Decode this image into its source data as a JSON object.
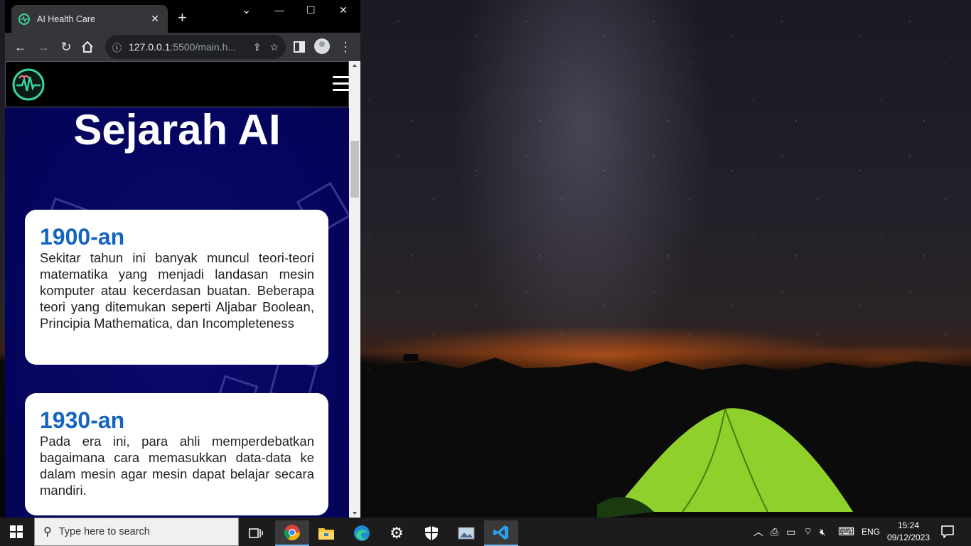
{
  "browser": {
    "tab_title": "AI Health Care",
    "tab_close": "✕",
    "new_tab": "+",
    "url_host": "127.0.0.1",
    "url_rest": ":5500/main.h...",
    "window_controls": {
      "minimize": "—",
      "maximize": "☐",
      "close": "✕",
      "tab_search": "⌄"
    }
  },
  "page": {
    "title": "Sejarah AI",
    "cards": [
      {
        "title": "1900-an",
        "text": "Sekitar tahun ini banyak muncul teori-teori matematika yang menjadi landasan mesin komputer atau kecerdasan buatan. Beberapa teori yang ditemukan seperti Aljabar Boolean, Principia Mathematica, dan Incompleteness"
      },
      {
        "title": "1930-an",
        "text": "Pada era ini, para ahli memperdebatkan bagaimana cara memasukkan data-data ke dalam mesin agar mesin dapat belajar secara mandiri."
      }
    ]
  },
  "taskbar": {
    "search_placeholder": "Type here to search",
    "language": "ENG",
    "time": "15:24",
    "date": "09/12/2023",
    "pinned_icons": [
      "task-view-icon",
      "chrome-icon",
      "file-explorer-icon",
      "edge-icon",
      "settings-icon",
      "security-icon",
      "photos-icon",
      "vscode-icon"
    ]
  },
  "colors": {
    "card_title": "#1565c0",
    "page_bg": "#050560",
    "taskbar_bg": "#1c1c1c"
  }
}
